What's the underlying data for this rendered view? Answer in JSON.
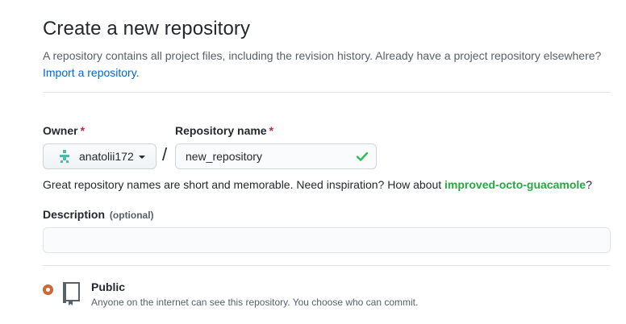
{
  "header": {
    "title": "Create a new repository",
    "subtitle": "A repository contains all project files, including the revision history. Already have a project repository elsewhere?",
    "import_link": "Import a repository."
  },
  "owner": {
    "label": "Owner",
    "required_mark": "*",
    "value": "anatolii172",
    "avatar_icon": "identicon-avatar"
  },
  "separator": "/",
  "repository": {
    "label": "Repository name",
    "required_mark": "*",
    "value": "new_repository",
    "valid_icon": "check-icon"
  },
  "name_hint": {
    "text": "Great repository names are short and memorable. Need inspiration? How about ",
    "suggestion": "improved-octo-guacamole",
    "suffix": "?"
  },
  "description": {
    "label": "Description",
    "optional_text": "(optional)",
    "value": ""
  },
  "visibility": {
    "selected": "public",
    "public_title": "Public",
    "public_desc": "Anyone on the internet can see this repository. You choose who can commit."
  },
  "colors": {
    "link": "#0366d6",
    "suggestion": "#28a745",
    "required": "#cb2431",
    "check": "#2cbe4e",
    "radio": "#d1683a",
    "avatar": "#4fb8a7"
  }
}
